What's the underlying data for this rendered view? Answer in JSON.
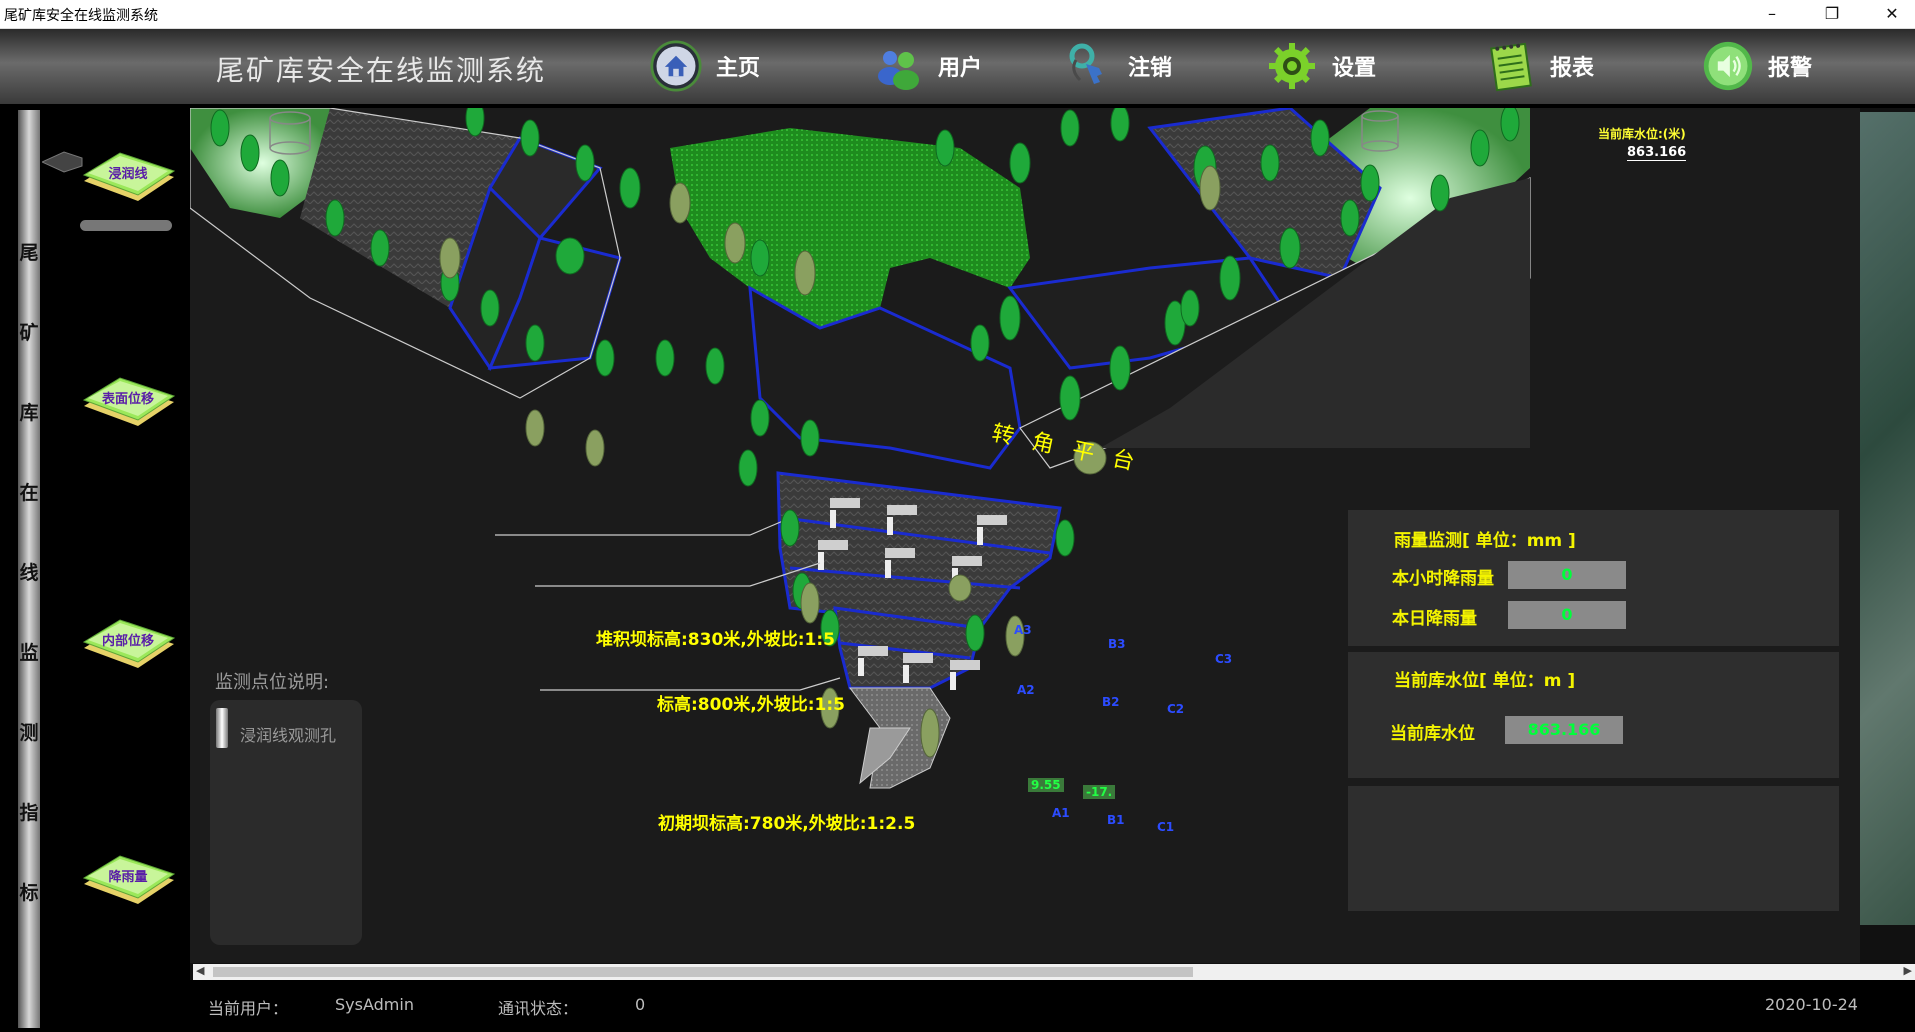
{
  "window": {
    "title": "尾矿库安全在线监测系统",
    "minimize_glyph": "–",
    "restore_glyph": "❐",
    "close_glyph": "✕"
  },
  "header": {
    "app_title": "尾矿库安全在线监测系统",
    "nav": [
      {
        "label": "主页",
        "icon": "home-icon"
      },
      {
        "label": "用户",
        "icon": "users-icon"
      },
      {
        "label": "注销",
        "icon": "key-icon"
      },
      {
        "label": "设置",
        "icon": "gear-icon"
      },
      {
        "label": "报表",
        "icon": "notepad-icon"
      },
      {
        "label": "报警",
        "icon": "speaker-icon"
      }
    ]
  },
  "sidebar": {
    "vertical_title": [
      "尾",
      "矿",
      "库",
      "在",
      "线",
      "监",
      "测",
      "指",
      "标"
    ],
    "items": [
      {
        "label": "浸润线"
      },
      {
        "label": "表面位移"
      },
      {
        "label": "内部位移"
      },
      {
        "label": "降雨量"
      }
    ]
  },
  "scene": {
    "platform_label": "转 角 平 台",
    "annotations": [
      "堆积坝标高:830米,外坡比:1:5",
      "标高:800米,外坡比:1:5",
      "初期坝标高:780米,外坡比:1:2.5"
    ],
    "water_level_label": "当前库水位:(米)",
    "water_level_value": "863.166",
    "points": {
      "row_a3": [
        "A3",
        "B3",
        "C3"
      ],
      "row_a2": [
        "A2",
        "B2",
        "C2"
      ],
      "row_a1": [
        "A1",
        "B1",
        "C1"
      ],
      "reading_a1": "9.55",
      "reading_b1": "-17."
    },
    "legend": {
      "title": "监测点位说明:",
      "item": "浸润线观测孔"
    }
  },
  "rain_panel": {
    "heading": "雨量监测[ 单位：mm ]",
    "hourly_label": "本小时降雨量",
    "hourly_value": "0",
    "daily_label": "本日降雨量",
    "daily_value": "0"
  },
  "water_panel": {
    "heading": "当前库水位[ 单位：m ]",
    "label": "当前库水位",
    "value": "863.166"
  },
  "status": {
    "user_label": "当前用户：",
    "user_value": "SysAdmin",
    "comm_label": "通讯状态：",
    "comm_value": "0",
    "date": "2020-10-24"
  },
  "colors": {
    "accent_yellow": "#ffff00",
    "value_green": "#00ff3a",
    "boundary_blue": "#1a2bd0"
  }
}
